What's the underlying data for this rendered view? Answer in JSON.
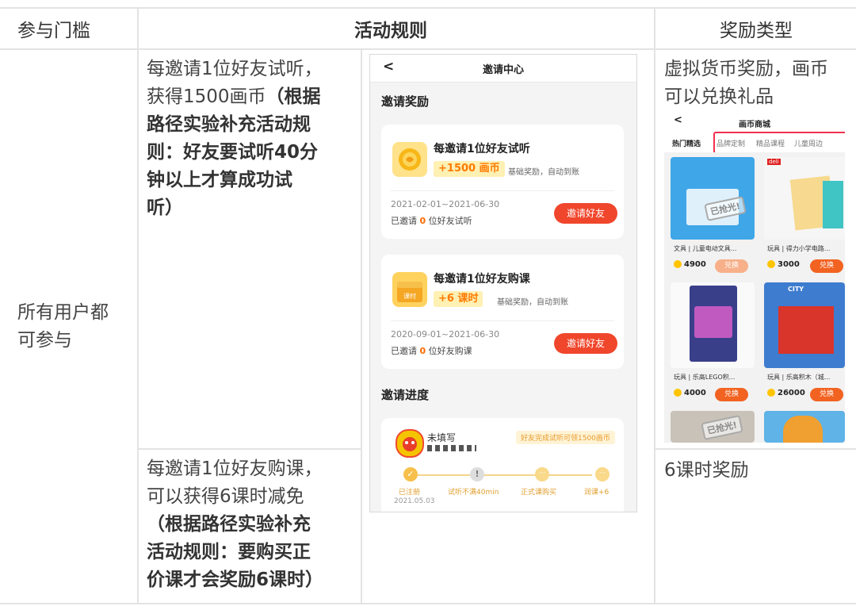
{
  "table": {
    "headers": [
      "参与门槛",
      "活动规则",
      "奖励类型"
    ],
    "row_label": [
      "所有用户都",
      "可参与"
    ],
    "rule1": {
      "normal": [
        "每邀请1位好友试听，",
        "获得1500画币"
      ],
      "bold_inline": "（根据",
      "bold": [
        "路径实验补充活动规",
        "则：好友要试听40分",
        "钟以上才算成功试",
        "听）"
      ]
    },
    "rule2": {
      "normal": [
        "每邀请1位好友购课，",
        "可以获得6课时减免"
      ],
      "bold": [
        "（根据路径实验补充",
        "活动规则：要购买正",
        "价课才会奖励6课时）"
      ]
    },
    "reward1": [
      "虚拟货币奖励，画币",
      "可以兑换礼品"
    ],
    "reward2": "6课时奖励"
  },
  "phone": {
    "back": "<",
    "title": "邀请中心",
    "section_reward": "邀请奖励",
    "section_progress": "邀请进度",
    "cards": [
      {
        "title": "每邀请1位好友试听",
        "pill": "+1500 画币",
        "note": "基础奖励，自动到账",
        "date": "2021-02-01~2021-06-30",
        "count_prefix": "已邀请",
        "count": "0",
        "count_suffix": "位好友试听",
        "button": "邀请好友"
      },
      {
        "title": "每邀请1位好友购课",
        "pill": "+6 课时",
        "note": "基础奖励，自动到账",
        "date": "2020-09-01~2021-06-30",
        "count_prefix": "已邀请",
        "count": "0",
        "count_suffix": "位好友购课",
        "button": "邀请好友",
        "icon_text": "课时"
      }
    ],
    "progress": {
      "name": "未填写",
      "tag": "好友完成试听可领1500画币",
      "steps": [
        "已注册",
        "试听不满40min",
        "正式课购买",
        "润课+6"
      ],
      "date": "2021.05.03"
    }
  },
  "mall": {
    "back": "<",
    "title": "画币商城",
    "tabs": [
      "热门精选",
      "品牌定制",
      "精品课程",
      "儿童周边"
    ],
    "stamp": "已抢光!",
    "products": [
      {
        "name": "文具 | 儿童电动文具...",
        "price": "4900",
        "button": "兑换"
      },
      {
        "name": "玩具 | 得力小学电路...",
        "price": "3000",
        "button": "兑换"
      },
      {
        "name": "玩具 | 乐高LEGO积...",
        "price": "4000",
        "button": "兑换"
      },
      {
        "name": "玩具 | 乐高积木（城...",
        "price": "26000",
        "button": "兑换"
      }
    ],
    "brand_label": "deli",
    "city_label": "CITY"
  },
  "colors": {
    "accent_red": "#f0462c",
    "accent_orange": "#ff7a00",
    "pill_bg": "#fff0b3",
    "grid_line": "#e3e3e3",
    "mall_highlight": "#f03050"
  }
}
